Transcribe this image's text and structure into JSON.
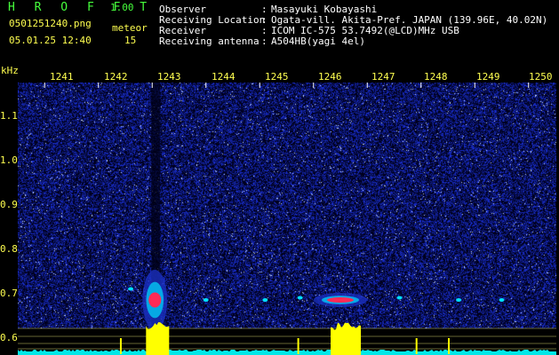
{
  "app": {
    "title": "H R O F F T",
    "version": "1.00",
    "filename": "0501251240.png",
    "datetime": "05.01.25 12:40",
    "meteor_label": "meteor",
    "meteor_count": "15"
  },
  "info": [
    {
      "label": "Observer",
      "sep": ":",
      "value": "Masayuki Kobayashi"
    },
    {
      "label": "Receiving Location",
      "sep": ":",
      "value": "Ogata-vill. Akita-Pref. JAPAN (139.96E, 40.02N)"
    },
    {
      "label": "Receiver",
      "sep": ":",
      "value": "ICOM IC-575 53.7492(@LCD)MHz USB"
    },
    {
      "label": "Receiving antenna",
      "sep": ":",
      "value": "A504HB(yagi 4el)"
    }
  ],
  "colors": {
    "title_green": "#46ff3c",
    "text_yellow": "#ffff50",
    "text_white": "#ffffff",
    "background": "#000000",
    "noise_blue": "#1a2fbf",
    "echo_red": "#ff2a55",
    "echo_cyan": "#00e0ff",
    "power_yellow": "#ffff00",
    "baseline_cyan": "#00e8e8"
  },
  "chart_data": {
    "type": "heatmap",
    "xlabel": "",
    "ylabel": "kHz",
    "x_ticks": [
      "1241",
      "1242",
      "1243",
      "1244",
      "1245",
      "1246",
      "1247",
      "1248",
      "1249",
      "1250"
    ],
    "y_ticks": [
      "1.1",
      "1.0",
      "0.9",
      "0.8",
      "0.7",
      "0.6"
    ],
    "ylim": [
      0.57,
      1.2
    ],
    "xlim": [
      1240.5,
      1250.5
    ],
    "echoes": [
      {
        "time": 1242.6,
        "freq_khz": 0.735,
        "intensity": "weak"
      },
      {
        "time": 1243.05,
        "freq_khz": 0.71,
        "intensity": "strong"
      },
      {
        "time": 1244.0,
        "freq_khz": 0.71,
        "intensity": "weak"
      },
      {
        "time": 1245.1,
        "freq_khz": 0.71,
        "intensity": "weak"
      },
      {
        "time": 1245.75,
        "freq_khz": 0.715,
        "intensity": "weak"
      },
      {
        "time": 1246.5,
        "freq_khz": 0.71,
        "intensity": "strong"
      },
      {
        "time": 1247.6,
        "freq_khz": 0.715,
        "intensity": "weak"
      },
      {
        "time": 1248.7,
        "freq_khz": 0.71,
        "intensity": "weak"
      },
      {
        "time": 1249.5,
        "freq_khz": 0.71,
        "intensity": "weak"
      }
    ],
    "power_peaks": [
      {
        "time": 1243.1,
        "level": "high"
      },
      {
        "time": 1246.6,
        "level": "high"
      },
      {
        "time": 1242.4,
        "level": "low"
      },
      {
        "time": 1245.7,
        "level": "low"
      },
      {
        "time": 1247.9,
        "level": "low"
      },
      {
        "time": 1248.5,
        "level": "low"
      }
    ]
  }
}
